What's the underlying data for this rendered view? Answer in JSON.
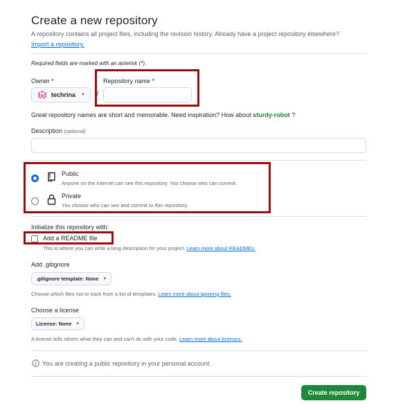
{
  "header": {
    "title": "Create a new repository",
    "subtitle": "A repository contains all project files, including the revision history. Already have a project repository elsewhere?",
    "import_link": "Import a repository."
  },
  "required_note": "Required fields are marked with an asterisk (*).",
  "owner": {
    "label": "Owner *",
    "value": "techrina"
  },
  "repo_name": {
    "label": "Repository name *",
    "value": ""
  },
  "name_hint": {
    "text": "Great repository names are short and memorable. Need inspiration? How about",
    "suggestion": "sturdy-robot",
    "suffix": "?"
  },
  "description": {
    "label": "Description",
    "optional": "(optional)",
    "value": ""
  },
  "visibility": {
    "public": {
      "label": "Public",
      "desc": "Anyone on the internet can see this repository. You choose who can commit.",
      "selected": true
    },
    "private": {
      "label": "Private",
      "desc": "You choose who can see and commit to this repository.",
      "selected": false
    }
  },
  "init": {
    "heading": "Initialize this repository with:",
    "readme_label": "Add a README file",
    "readme_checked": false,
    "readme_desc": "This is where you can write a long description for your project.",
    "readme_link": "Learn more about READMEs."
  },
  "gitignore": {
    "heading": "Add .gitignore",
    "button": ".gitignore template: None",
    "desc": "Choose which files not to track from a list of templates.",
    "link": "Learn more about ignoring files."
  },
  "license": {
    "heading": "Choose a license",
    "button": "License: None",
    "desc": "A license tells others what they can and can't do with your code.",
    "link": "Learn more about licenses."
  },
  "info_note": "You are creating a public repository in your personal account.",
  "submit_label": "Create repository",
  "colors": {
    "accent_blue": "#0969da",
    "primary_green": "#1f883d",
    "highlight_red": "#9c0b0b"
  },
  "icons": [
    "avatar-identicon",
    "chevron-down-icon",
    "repo-icon",
    "lock-icon",
    "info-icon"
  ]
}
